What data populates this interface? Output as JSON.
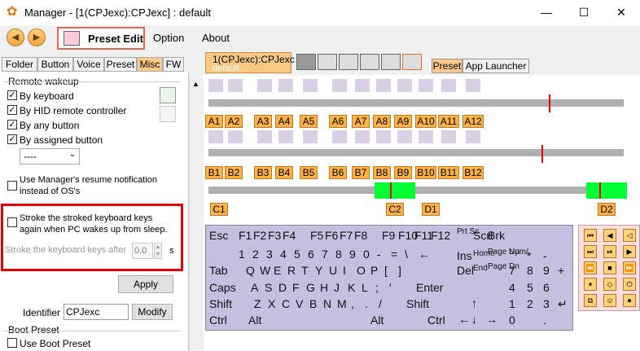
{
  "window": {
    "title": "Manager - [1(CPJexc):CPJexc] : default",
    "minimize": "—",
    "maximize": "☐",
    "close": "✕"
  },
  "toolbar": {
    "back": "◀",
    "forward": "▶",
    "preset_edit": "Preset Edit",
    "menu": [
      "Option",
      "About"
    ]
  },
  "left_tabs": [
    "Folder",
    "Button",
    "Voice",
    "Preset",
    "Misc",
    "FW"
  ],
  "left_tabs_active": "Misc",
  "remote_wakeup": {
    "title": "Remote wakeup",
    "items": [
      {
        "label": "By keyboard",
        "checked": true
      },
      {
        "label": "By HID remote controller",
        "checked": true
      },
      {
        "label": "By any button",
        "checked": true
      },
      {
        "label": "By assigned button",
        "checked": true
      }
    ],
    "assigned_select": "----",
    "resume_line1": "Use Manager's resume notification",
    "resume_line2": "instead of OS's"
  },
  "stroke": {
    "line1": "Stroke the stroked keyboard keys",
    "line2": "again when PC wakes up from sleep.",
    "after_label": "Stroke the keyboard keys after",
    "after_value": "0.0",
    "unit": "s"
  },
  "apply_label": "Apply",
  "identifier": {
    "label": "Identifier",
    "value": "CPJexc",
    "modify": "Modify"
  },
  "boot_preset": {
    "title": "Boot Preset",
    "use_label": "Use Boot Preset"
  },
  "canvas_tab": {
    "name": "1(CPJexc):CPJexc",
    "sub": "default"
  },
  "right_tabs": [
    "Preset",
    "App Launcher"
  ],
  "a_labels": [
    "A1",
    "A2",
    "A3",
    "A4",
    "A5",
    "A6",
    "A7",
    "A8",
    "A9",
    "A10",
    "A11",
    "A12"
  ],
  "b_labels": [
    "B1",
    "B2",
    "B3",
    "B4",
    "B5",
    "B6",
    "B7",
    "B8",
    "B9",
    "B10",
    "B11",
    "B12"
  ],
  "c_labels": [
    "C1",
    "C2"
  ],
  "d_labels": [
    "D1",
    "D2"
  ],
  "keyboard": {
    "row1": [
      "Esc",
      "F1",
      "F2",
      "F3",
      "F4",
      "F5",
      "F6",
      "F7",
      "F8",
      "F9",
      "F10",
      "F11",
      "F12"
    ],
    "row2": [
      "1",
      "2",
      "3",
      "4",
      "5",
      "6",
      "7",
      "8",
      "9",
      "0",
      "-",
      "=",
      "\\",
      "←"
    ],
    "row3": [
      "Tab",
      "Q",
      "W",
      "E",
      "R",
      "T",
      "Y",
      "U",
      "I",
      "O",
      "P",
      "[",
      "]"
    ],
    "row4": [
      "Caps",
      "A",
      "S",
      "D",
      "F",
      "G",
      "H",
      "J",
      "K",
      "L",
      ";",
      "'",
      "Enter"
    ],
    "row5": [
      "Shift",
      "Z",
      "X",
      "C",
      "V",
      "B",
      "N",
      "M",
      ",",
      ".",
      "/",
      "Shift"
    ],
    "row6": [
      "Ctrl",
      "Alt",
      "Alt",
      "Ctrl"
    ],
    "nav": [
      "Prt Sc",
      "Scrl",
      "Brk",
      "Ins",
      "Home",
      "Page Up",
      "Del",
      "End",
      "Page Dn",
      "↑",
      "←",
      "↓",
      "→"
    ],
    "numpad": [
      "Num/",
      "*",
      "-",
      "7",
      "8",
      "9",
      "+",
      "4",
      "5",
      "6",
      "1",
      "2",
      "3",
      "↵",
      "0",
      "."
    ]
  }
}
